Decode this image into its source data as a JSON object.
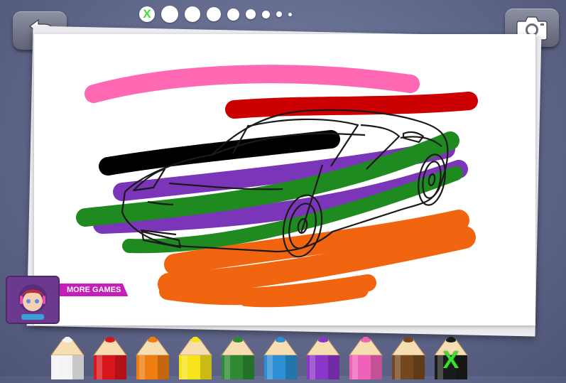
{
  "toolbar": {
    "back_button_icon": "back-arrow-icon",
    "camera_button_icon": "camera-icon",
    "eraser_mark": "X"
  },
  "brushes": [
    {
      "size": "eraser"
    },
    {
      "size": 24
    },
    {
      "size": 22
    },
    {
      "size": 20
    },
    {
      "size": 17
    },
    {
      "size": 14
    },
    {
      "size": 11
    },
    {
      "size": 8
    },
    {
      "size": 5
    }
  ],
  "promo": {
    "label": "MORE GAMES"
  },
  "pencils": [
    {
      "color": "#f4f4f4",
      "name": "white"
    },
    {
      "color": "#d9161b",
      "name": "red"
    },
    {
      "color": "#f07d10",
      "name": "orange"
    },
    {
      "color": "#f7e31a",
      "name": "yellow"
    },
    {
      "color": "#2f8a34",
      "name": "green"
    },
    {
      "color": "#2c8fd4",
      "name": "blue"
    },
    {
      "color": "#8a36c8",
      "name": "purple"
    },
    {
      "color": "#f062b8",
      "name": "pink"
    },
    {
      "color": "#74481e",
      "name": "brown"
    },
    {
      "color": "#1b1b1b",
      "name": "black",
      "selected": true,
      "mark": "X"
    }
  ],
  "strokes": {
    "pink": "#ff69b4",
    "red": "#cc0000",
    "black": "#000000",
    "purple": "#7b35b8",
    "green": "#1f8a1f",
    "orange": "#f26510"
  }
}
